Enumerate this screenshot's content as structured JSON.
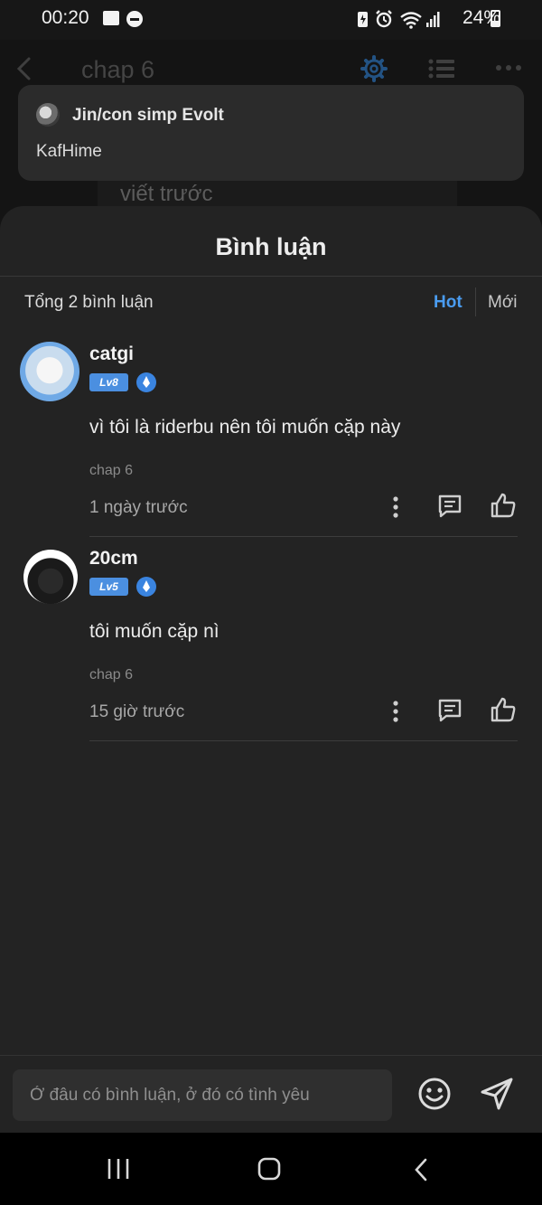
{
  "status_bar": {
    "time": "00:20",
    "battery": "24%",
    "battery_level": 0.24,
    "icons": [
      "image-icon",
      "dnd-icon",
      "battery-saver-icon",
      "alarm-icon",
      "wifi-icon",
      "signal-icon",
      "battery-icon"
    ]
  },
  "reader": {
    "title": "chap 6",
    "behind_text": "viết trước",
    "icons": [
      "back-icon",
      "settings-gear-icon",
      "list-icon",
      "more-icon"
    ],
    "accent": "#2f6fb0"
  },
  "tooltip": {
    "name": "Jin/con simp Evolt",
    "text": "KafHime"
  },
  "comments_sheet": {
    "title": "Bình luận",
    "total": "Tổng 2 bình luận",
    "sort_hot": "Hot",
    "sort_new": "Mới",
    "accent": "#4a9cf0",
    "comments": [
      {
        "user": "catgi",
        "level": "Lv8",
        "text": "vì tôi là riderbu nên tôi muốn cặp này",
        "chapter": "chap 6",
        "time": "1 ngày trước"
      },
      {
        "user": "20cm",
        "level": "Lv5",
        "text": "tôi muốn cặp nì",
        "chapter": "chap 6",
        "time": "15 giờ trước"
      }
    ]
  },
  "input_bar": {
    "placeholder": "Ở đâu có bình luận, ở đó có tình yêu",
    "value": "",
    "icons": [
      "emoji-icon",
      "send-icon"
    ]
  },
  "nav_bar": {
    "icons": [
      "recent-apps-icon",
      "home-icon",
      "back-icon"
    ]
  }
}
